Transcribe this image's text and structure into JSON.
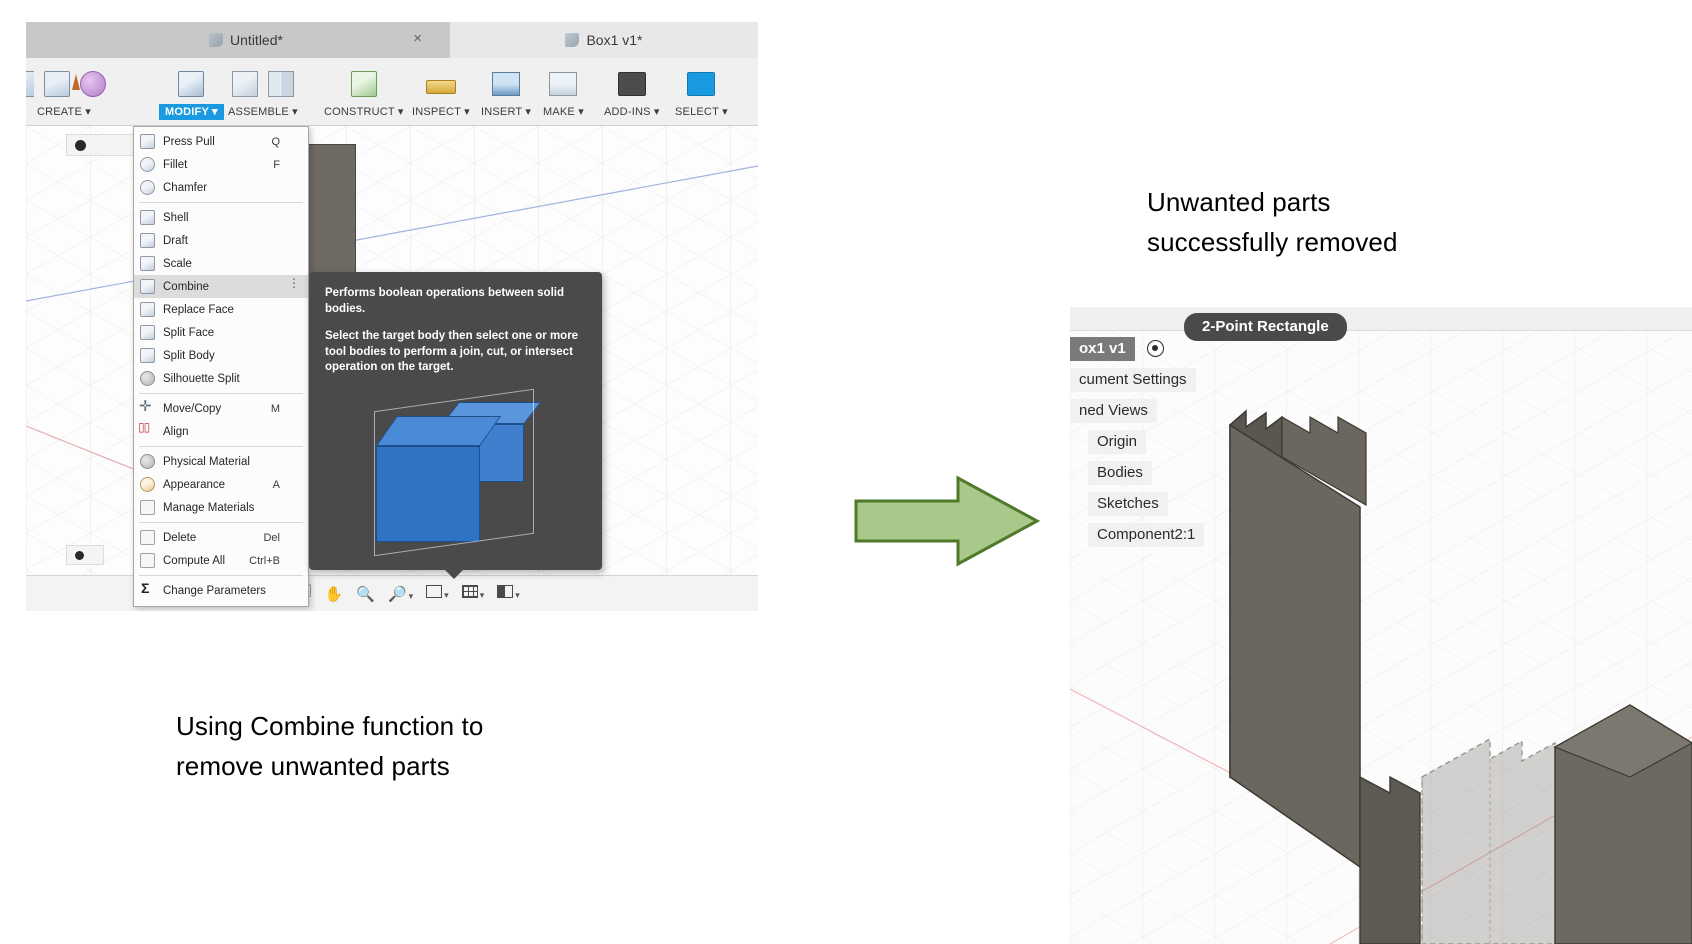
{
  "left_screenshot": {
    "tabs": [
      {
        "label": "Untitled*",
        "icon": "document-icon",
        "active": false,
        "closable": true
      },
      {
        "label": "Box1 v1*",
        "icon": "document-icon",
        "active": true,
        "closable": false
      }
    ],
    "ribbon_groups": [
      {
        "label": "CREATE",
        "dropdown": true,
        "selected": false,
        "icons": [
          "extrude-icon",
          "mesh-icon"
        ]
      },
      {
        "label": "MODIFY",
        "dropdown": true,
        "selected": true,
        "icons": [
          "press-pull-icon"
        ]
      },
      {
        "label": "ASSEMBLE",
        "dropdown": true,
        "selected": false,
        "icons": [
          "new-component-icon",
          "mirror-icon"
        ]
      },
      {
        "label": "CONSTRUCT",
        "dropdown": true,
        "selected": false,
        "icons": [
          "offset-plane-icon"
        ]
      },
      {
        "label": "INSPECT",
        "dropdown": true,
        "selected": false,
        "icons": [
          "measure-icon"
        ]
      },
      {
        "label": "INSERT",
        "dropdown": true,
        "selected": false,
        "icons": [
          "insert-image-icon"
        ]
      },
      {
        "label": "MAKE",
        "dropdown": true,
        "selected": false,
        "icons": [
          "3d-print-icon"
        ]
      },
      {
        "label": "ADD-INS",
        "dropdown": true,
        "selected": false,
        "icons": [
          "script-icon"
        ]
      },
      {
        "label": "SELECT",
        "dropdown": true,
        "selected": false,
        "icons": [
          "select-icon"
        ]
      }
    ],
    "modify_menu": {
      "items": [
        {
          "label": "Press Pull",
          "shortcut": "Q",
          "icon": "press-pull-icon",
          "highlighted": false
        },
        {
          "label": "Fillet",
          "shortcut": "F",
          "icon": "fillet-icon",
          "highlighted": false
        },
        {
          "label": "Chamfer",
          "shortcut": "",
          "icon": "chamfer-icon",
          "highlighted": false
        },
        {
          "separator": true
        },
        {
          "label": "Shell",
          "shortcut": "",
          "icon": "shell-icon",
          "highlighted": false
        },
        {
          "label": "Draft",
          "shortcut": "",
          "icon": "draft-icon",
          "highlighted": false
        },
        {
          "label": "Scale",
          "shortcut": "",
          "icon": "scale-icon",
          "highlighted": false
        },
        {
          "label": "Combine",
          "shortcut": "",
          "icon": "combine-icon",
          "highlighted": true,
          "overflow": "⋮"
        },
        {
          "label": "Replace Face",
          "shortcut": "",
          "icon": "replace-face-icon",
          "highlighted": false
        },
        {
          "label": "Split Face",
          "shortcut": "",
          "icon": "split-face-icon",
          "highlighted": false
        },
        {
          "label": "Split Body",
          "shortcut": "",
          "icon": "split-body-icon",
          "highlighted": false
        },
        {
          "label": "Silhouette Split",
          "shortcut": "",
          "icon": "silhouette-split-icon",
          "highlighted": false
        },
        {
          "separator": true
        },
        {
          "label": "Move/Copy",
          "shortcut": "M",
          "icon": "move-copy-icon",
          "highlighted": false
        },
        {
          "label": "Align",
          "shortcut": "",
          "icon": "align-icon",
          "highlighted": false
        },
        {
          "separator": true
        },
        {
          "label": "Physical Material",
          "shortcut": "",
          "icon": "physical-material-icon",
          "highlighted": false
        },
        {
          "label": "Appearance",
          "shortcut": "A",
          "icon": "appearance-icon",
          "highlighted": false
        },
        {
          "label": "Manage Materials",
          "shortcut": "",
          "icon": "manage-materials-icon",
          "highlighted": false
        },
        {
          "separator": true
        },
        {
          "label": "Delete",
          "shortcut": "Del",
          "icon": "delete-icon",
          "highlighted": false
        },
        {
          "label": "Compute All",
          "shortcut": "Ctrl+B",
          "icon": "compute-all-icon",
          "highlighted": false
        },
        {
          "separator": true
        },
        {
          "label": "Change Parameters",
          "shortcut": "",
          "icon": "change-parameters-icon",
          "highlighted": false
        }
      ]
    },
    "tooltip": {
      "line1": "Performs boolean operations between solid bodies.",
      "line2": "Select the target body then select one or more tool bodies to perform a join, cut, or intersect operation on the target.",
      "preview_alt": "two blue solid bodies overlapping"
    },
    "navbar_items": [
      {
        "icon": "orbit-icon",
        "glyph": "◉",
        "dropdown": true
      },
      {
        "icon": "look-at-icon",
        "glyph": "⛶",
        "dropdown": false
      },
      {
        "icon": "pan-icon",
        "glyph": "✋",
        "dropdown": false
      },
      {
        "icon": "zoom-icon",
        "glyph": "🔍",
        "dropdown": false
      },
      {
        "icon": "zoom-window-icon",
        "glyph": "🔎",
        "dropdown": true
      },
      {
        "icon": "display-settings-icon",
        "glyph": "▭",
        "dropdown": true
      },
      {
        "icon": "grid-snap-icon",
        "glyph": "▦",
        "dropdown": true
      },
      {
        "icon": "viewports-icon",
        "glyph": "▤",
        "dropdown": true
      }
    ]
  },
  "right_screenshot": {
    "badge": "2-Point Rectangle",
    "tree": [
      {
        "label": "ox1 v1",
        "type": "document",
        "has_eye": true,
        "clipped": true
      },
      {
        "label": "cument Settings",
        "type": "node",
        "clipped": true
      },
      {
        "label": "ned Views",
        "type": "node",
        "clipped": true
      },
      {
        "label": "Origin",
        "type": "node",
        "indent": 1
      },
      {
        "label": "Bodies",
        "type": "node",
        "indent": 1
      },
      {
        "label": "Sketches",
        "type": "node",
        "indent": 1
      },
      {
        "label": "Component2:1",
        "type": "node",
        "indent": 1
      }
    ]
  },
  "captions": {
    "left_line1": "Using Combine function to",
    "left_line2": "remove unwanted parts",
    "right_line1": "Unwanted parts",
    "right_line2": "successfully removed"
  },
  "arrow": {
    "name": "right-arrow",
    "fill": "#a9c98a",
    "stroke": "#4f7a2a"
  },
  "colors": {
    "accent_blue": "#1a9ae0",
    "tooltip_bg": "#4a4a4a",
    "body_gray": "#6e6a63",
    "arrow_green": "#a9c98a"
  }
}
